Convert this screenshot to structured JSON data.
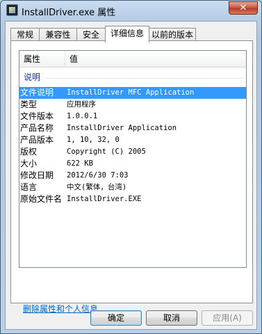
{
  "window": {
    "title": "InstallDriver.exe 属性",
    "close_glyph": "✕"
  },
  "tabs": [
    {
      "label": "常规",
      "active": false
    },
    {
      "label": "兼容性",
      "active": false
    },
    {
      "label": "安全",
      "active": false
    },
    {
      "label": "详细信息",
      "active": true
    },
    {
      "label": "以前的版本",
      "active": false
    }
  ],
  "details": {
    "columns": {
      "property": "属性",
      "value": "值"
    },
    "group": "说明",
    "rows": [
      {
        "property": "文件说明",
        "value": "InstallDriver MFC Application",
        "selected": true
      },
      {
        "property": "类型",
        "value": "应用程序"
      },
      {
        "property": "文件版本",
        "value": "1.0.0.1"
      },
      {
        "property": "产品名称",
        "value": "InstallDriver Application"
      },
      {
        "property": "产品版本",
        "value": "1, 10, 32, 0"
      },
      {
        "property": "版权",
        "value": "Copyright (C) 2005"
      },
      {
        "property": "大小",
        "value": "622 KB"
      },
      {
        "property": "修改日期",
        "value": "2012/6/30 7:03"
      },
      {
        "property": "语言",
        "value": "中文(繁体，台湾)"
      },
      {
        "property": "原始文件名",
        "value": "InstallDriver.EXE"
      }
    ]
  },
  "remove_link": "删除属性和个人信息",
  "buttons": {
    "ok": "确定",
    "cancel": "取消",
    "apply": "应用(A)"
  },
  "colors": {
    "selection": "#3399ff",
    "link": "#0066cc",
    "group_text": "#1e3287"
  }
}
